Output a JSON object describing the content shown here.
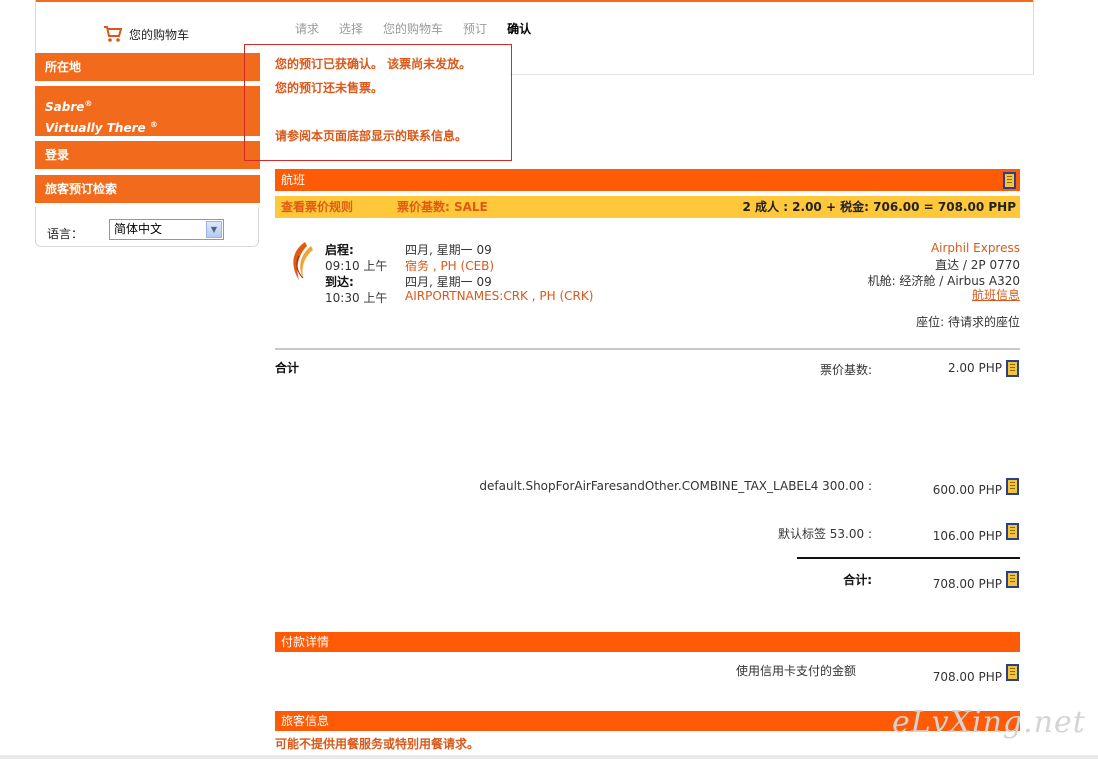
{
  "cart": {
    "label": "您的购物车"
  },
  "steps": [
    "请求",
    "选择",
    "您的购物车",
    "预订",
    "确认"
  ],
  "sidebar": {
    "location": "所在地",
    "sabre": "Sabre",
    "virtually_there": "Virtually There",
    "login": "登录",
    "traveler_search": "旅客预订检索",
    "language_label": "语言：",
    "language_value": "简体中文"
  },
  "confirmation": {
    "line1": "您的预订已获确认。 该票尚未发放。",
    "line2": "您的预订还未售票。",
    "line3": "请参阅本页面底部显示的联系信息。"
  },
  "flight_section": {
    "title": "航班",
    "fare_rules_link": "查看票价规则",
    "fare_basis": "票价基数: SALE",
    "total_summary": "2 成人 : 2.00 + 税金: 706.00 = 708.00 PHP",
    "depart_label": "启程:",
    "depart_time": "09:10 上午",
    "depart_date": "四月, 星期一 09",
    "depart_place": "宿务 , PH (CEB)",
    "arrive_label": "到达:",
    "arrive_time": "10:30 上午",
    "arrive_date": "四月, 星期一 09",
    "arrive_place": "AIRPORTNAMES:CRK , PH (CRK)",
    "airline": "Airphil Express",
    "nonstop": "直达 / 2P 0770",
    "cabin": "机舱: 经济舱 / Airbus A320",
    "flight_info_link": "航班信息",
    "seat": "座位: 待请求的座位"
  },
  "totals": {
    "heading": "合计",
    "base_label": "票价基数:",
    "base_value": "2.00 PHP",
    "tax1_label": "default.ShopForAirFaresandOther.COMBINE_TAX_LABEL4  300.00 :",
    "tax1_value": "600.00 PHP",
    "tax2_label": "默认标签  53.00 :",
    "tax2_value": "106.00 PHP",
    "sum_label": "合计:",
    "sum_value": "708.00  PHP"
  },
  "payment": {
    "title": "付款详情",
    "card_label": "使用信用卡支付的金额",
    "card_value": "708.00 PHP"
  },
  "traveler": {
    "title": "旅客信息",
    "meal_note": "可能不提供用餐服务或特别用餐请求。"
  },
  "watermark": "eLvXing.net",
  "colors": {
    "accent": "#f26a1b",
    "section": "#ff5a05",
    "fare_bar": "#ffc83a",
    "link": "#d9591a"
  }
}
